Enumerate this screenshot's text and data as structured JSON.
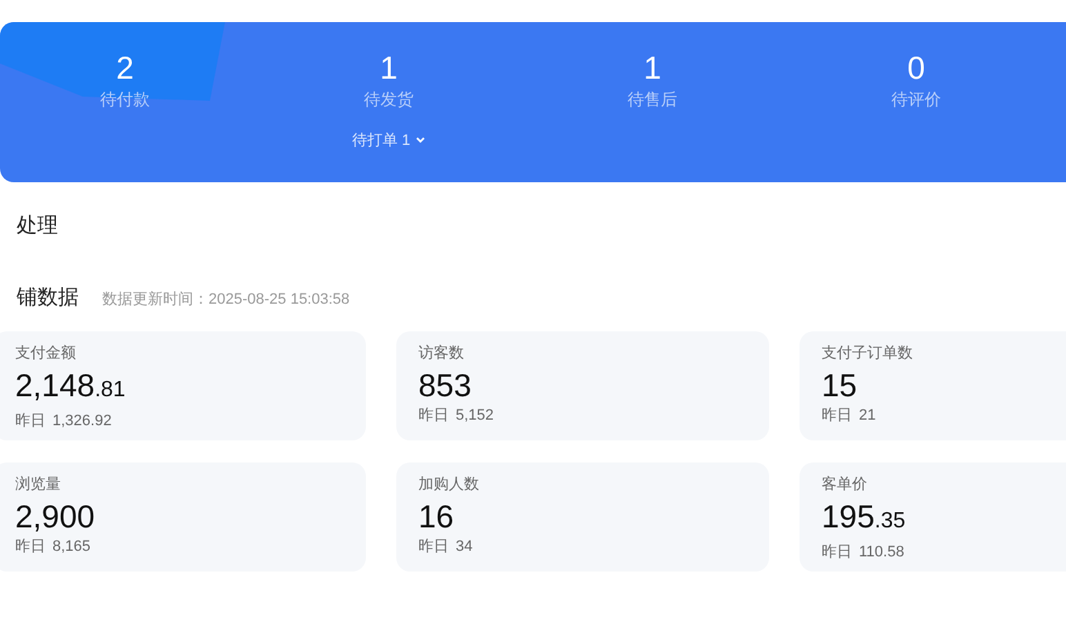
{
  "order_status": [
    {
      "count": "2",
      "label": "待付款"
    },
    {
      "count": "1",
      "label": "待发货",
      "dropdown": {
        "label": "待打单 1",
        "expanded": false
      }
    },
    {
      "count": "1",
      "label": "待售后"
    },
    {
      "count": "0",
      "label": "待评价"
    }
  ],
  "pending_section": {
    "title": "处理"
  },
  "store_data": {
    "title": "铺数据",
    "updated": "数据更新时间：2025-08-25 15:03:58",
    "metrics": [
      {
        "label": "支付金额",
        "value": "2,148",
        "decimal": ".81",
        "yesterday_label": "昨日",
        "yesterday": "1,326.92"
      },
      {
        "label": "访客数",
        "value": "853",
        "yesterday_label": "昨日",
        "yesterday": "5,152"
      },
      {
        "label": "支付子订单数",
        "value": "15",
        "yesterday_label": "昨日",
        "yesterday": "21"
      },
      {
        "label": "浏览量",
        "value": "2,900",
        "yesterday_label": "昨日",
        "yesterday": "8,165"
      },
      {
        "label": "加购人数",
        "value": "16",
        "yesterday_label": "昨日",
        "yesterday": "34"
      },
      {
        "label": "客单价",
        "value": "195",
        "decimal": ".35",
        "yesterday_label": "昨日",
        "yesterday": "110.58"
      }
    ]
  }
}
